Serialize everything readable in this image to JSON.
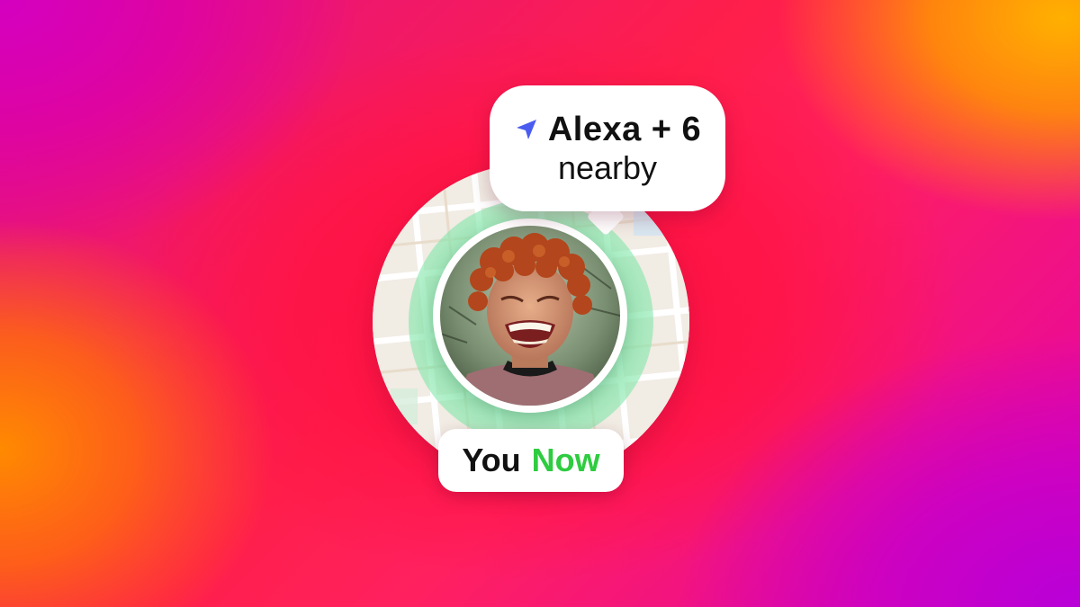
{
  "bubble": {
    "icon": "navigation-arrow-icon",
    "name": "Alexa + 6",
    "subtitle": "nearby"
  },
  "status_pill": {
    "primary": "You",
    "secondary": "Now"
  },
  "colors": {
    "nav_icon": "#4a5cf0",
    "now_green": "#2ecc40",
    "halo_green": "#7ee6a0"
  }
}
